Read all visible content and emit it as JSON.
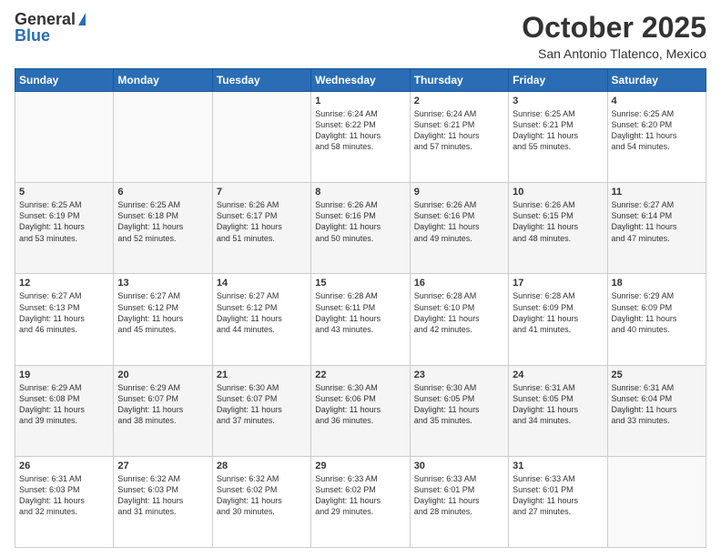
{
  "header": {
    "logo_general": "General",
    "logo_blue": "Blue",
    "title": "October 2025",
    "location": "San Antonio Tlatenco, Mexico"
  },
  "weekdays": [
    "Sunday",
    "Monday",
    "Tuesday",
    "Wednesday",
    "Thursday",
    "Friday",
    "Saturday"
  ],
  "weeks": [
    [
      {
        "day": "",
        "info": ""
      },
      {
        "day": "",
        "info": ""
      },
      {
        "day": "",
        "info": ""
      },
      {
        "day": "1",
        "info": "Sunrise: 6:24 AM\nSunset: 6:22 PM\nDaylight: 11 hours\nand 58 minutes."
      },
      {
        "day": "2",
        "info": "Sunrise: 6:24 AM\nSunset: 6:21 PM\nDaylight: 11 hours\nand 57 minutes."
      },
      {
        "day": "3",
        "info": "Sunrise: 6:25 AM\nSunset: 6:21 PM\nDaylight: 11 hours\nand 55 minutes."
      },
      {
        "day": "4",
        "info": "Sunrise: 6:25 AM\nSunset: 6:20 PM\nDaylight: 11 hours\nand 54 minutes."
      }
    ],
    [
      {
        "day": "5",
        "info": "Sunrise: 6:25 AM\nSunset: 6:19 PM\nDaylight: 11 hours\nand 53 minutes."
      },
      {
        "day": "6",
        "info": "Sunrise: 6:25 AM\nSunset: 6:18 PM\nDaylight: 11 hours\nand 52 minutes."
      },
      {
        "day": "7",
        "info": "Sunrise: 6:26 AM\nSunset: 6:17 PM\nDaylight: 11 hours\nand 51 minutes."
      },
      {
        "day": "8",
        "info": "Sunrise: 6:26 AM\nSunset: 6:16 PM\nDaylight: 11 hours\nand 50 minutes."
      },
      {
        "day": "9",
        "info": "Sunrise: 6:26 AM\nSunset: 6:16 PM\nDaylight: 11 hours\nand 49 minutes."
      },
      {
        "day": "10",
        "info": "Sunrise: 6:26 AM\nSunset: 6:15 PM\nDaylight: 11 hours\nand 48 minutes."
      },
      {
        "day": "11",
        "info": "Sunrise: 6:27 AM\nSunset: 6:14 PM\nDaylight: 11 hours\nand 47 minutes."
      }
    ],
    [
      {
        "day": "12",
        "info": "Sunrise: 6:27 AM\nSunset: 6:13 PM\nDaylight: 11 hours\nand 46 minutes."
      },
      {
        "day": "13",
        "info": "Sunrise: 6:27 AM\nSunset: 6:12 PM\nDaylight: 11 hours\nand 45 minutes."
      },
      {
        "day": "14",
        "info": "Sunrise: 6:27 AM\nSunset: 6:12 PM\nDaylight: 11 hours\nand 44 minutes."
      },
      {
        "day": "15",
        "info": "Sunrise: 6:28 AM\nSunset: 6:11 PM\nDaylight: 11 hours\nand 43 minutes."
      },
      {
        "day": "16",
        "info": "Sunrise: 6:28 AM\nSunset: 6:10 PM\nDaylight: 11 hours\nand 42 minutes."
      },
      {
        "day": "17",
        "info": "Sunrise: 6:28 AM\nSunset: 6:09 PM\nDaylight: 11 hours\nand 41 minutes."
      },
      {
        "day": "18",
        "info": "Sunrise: 6:29 AM\nSunset: 6:09 PM\nDaylight: 11 hours\nand 40 minutes."
      }
    ],
    [
      {
        "day": "19",
        "info": "Sunrise: 6:29 AM\nSunset: 6:08 PM\nDaylight: 11 hours\nand 39 minutes."
      },
      {
        "day": "20",
        "info": "Sunrise: 6:29 AM\nSunset: 6:07 PM\nDaylight: 11 hours\nand 38 minutes."
      },
      {
        "day": "21",
        "info": "Sunrise: 6:30 AM\nSunset: 6:07 PM\nDaylight: 11 hours\nand 37 minutes."
      },
      {
        "day": "22",
        "info": "Sunrise: 6:30 AM\nSunset: 6:06 PM\nDaylight: 11 hours\nand 36 minutes."
      },
      {
        "day": "23",
        "info": "Sunrise: 6:30 AM\nSunset: 6:05 PM\nDaylight: 11 hours\nand 35 minutes."
      },
      {
        "day": "24",
        "info": "Sunrise: 6:31 AM\nSunset: 6:05 PM\nDaylight: 11 hours\nand 34 minutes."
      },
      {
        "day": "25",
        "info": "Sunrise: 6:31 AM\nSunset: 6:04 PM\nDaylight: 11 hours\nand 33 minutes."
      }
    ],
    [
      {
        "day": "26",
        "info": "Sunrise: 6:31 AM\nSunset: 6:03 PM\nDaylight: 11 hours\nand 32 minutes."
      },
      {
        "day": "27",
        "info": "Sunrise: 6:32 AM\nSunset: 6:03 PM\nDaylight: 11 hours\nand 31 minutes."
      },
      {
        "day": "28",
        "info": "Sunrise: 6:32 AM\nSunset: 6:02 PM\nDaylight: 11 hours\nand 30 minutes."
      },
      {
        "day": "29",
        "info": "Sunrise: 6:33 AM\nSunset: 6:02 PM\nDaylight: 11 hours\nand 29 minutes."
      },
      {
        "day": "30",
        "info": "Sunrise: 6:33 AM\nSunset: 6:01 PM\nDaylight: 11 hours\nand 28 minutes."
      },
      {
        "day": "31",
        "info": "Sunrise: 6:33 AM\nSunset: 6:01 PM\nDaylight: 11 hours\nand 27 minutes."
      },
      {
        "day": "",
        "info": ""
      }
    ]
  ]
}
